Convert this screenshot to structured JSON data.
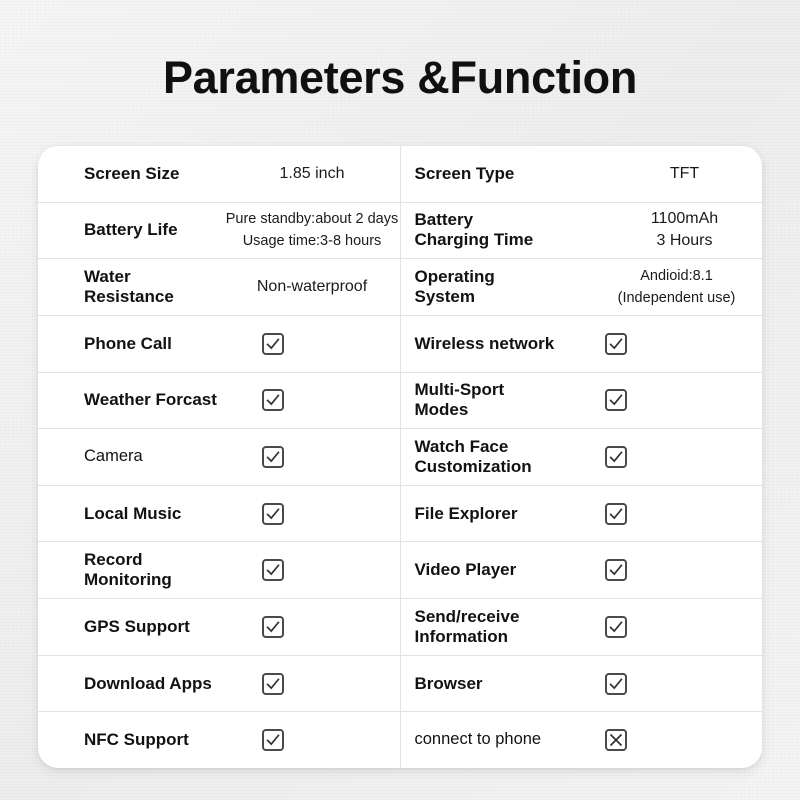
{
  "page": {
    "title": "Parameters &Function",
    "background_color": "#f3f3f3",
    "card_color": "#ffffff",
    "text_color": "#121212",
    "divider_color": "#e2e2e2",
    "checkbox_border_color": "#4a4a4a"
  },
  "table": {
    "rows": [
      {
        "left": {
          "label": "Screen Size",
          "value": "1.85 inch",
          "type": "text"
        },
        "right": {
          "label": "Screen Type",
          "value": "TFT",
          "type": "text",
          "align": "left"
        }
      },
      {
        "left": {
          "label": "Battery Life",
          "value": "Pure standby:about 2 days\nUsage time:3-8 hours",
          "type": "text",
          "size": "small"
        },
        "right": {
          "label": "Battery\nCharging Time",
          "value": "1100mAh\n3 Hours",
          "type": "text",
          "align": "left"
        }
      },
      {
        "left": {
          "label": "Water\nResistance",
          "value": "Non-waterproof",
          "type": "text"
        },
        "right": {
          "label": "Operating\nSystem",
          "value": "Andioid:8.1\n(Independent use)",
          "type": "text",
          "size": "small"
        }
      },
      {
        "left": {
          "label": "Phone Call",
          "value": "checked",
          "type": "checkbox"
        },
        "right": {
          "label": "Wireless network",
          "value": "checked",
          "type": "checkbox"
        }
      },
      {
        "left": {
          "label": "Weather Forcast",
          "value": "checked",
          "type": "checkbox"
        },
        "right": {
          "label": "Multi-Sport\nModes",
          "value": "checked",
          "type": "checkbox"
        }
      },
      {
        "left": {
          "label": "Camera",
          "value": "checked",
          "type": "checkbox",
          "weight": "light"
        },
        "right": {
          "label": "Watch Face\nCustomization",
          "value": "checked",
          "type": "checkbox"
        }
      },
      {
        "left": {
          "label": "Local Music",
          "value": "checked",
          "type": "checkbox"
        },
        "right": {
          "label": "File Explorer",
          "value": "checked",
          "type": "checkbox"
        }
      },
      {
        "left": {
          "label": "Record\nMonitoring",
          "value": "checked",
          "type": "checkbox"
        },
        "right": {
          "label": "Video Player",
          "value": "checked",
          "type": "checkbox"
        }
      },
      {
        "left": {
          "label": "GPS Support",
          "value": "checked",
          "type": "checkbox"
        },
        "right": {
          "label": "Send/receive\nInformation",
          "value": "checked",
          "type": "checkbox"
        }
      },
      {
        "left": {
          "label": "Download Apps",
          "value": "checked",
          "type": "checkbox"
        },
        "right": {
          "label": "Browser",
          "value": "checked",
          "type": "checkbox"
        }
      },
      {
        "left": {
          "label": "NFC Support",
          "value": "checked",
          "type": "checkbox"
        },
        "right": {
          "label": "connect to phone",
          "value": "crossed",
          "type": "checkbox",
          "weight": "light"
        }
      }
    ]
  },
  "icons": {
    "checked": "checkbox-checked-icon",
    "crossed": "checkbox-crossed-icon"
  }
}
